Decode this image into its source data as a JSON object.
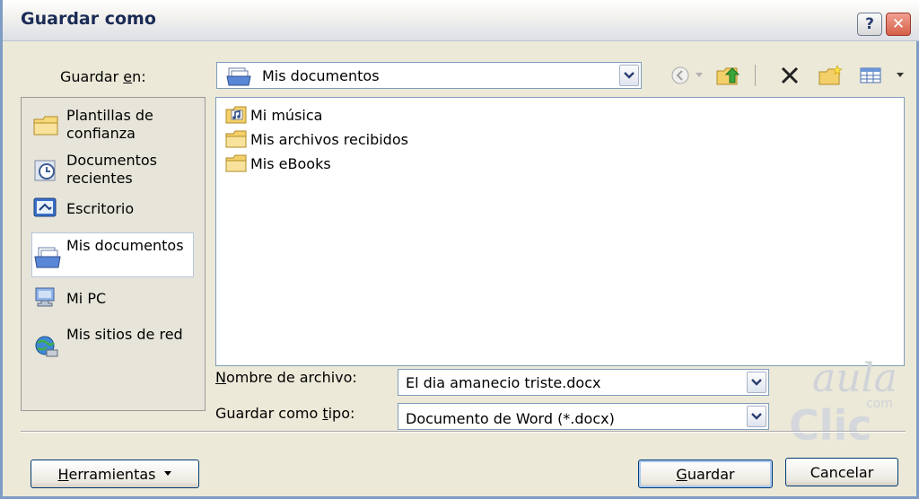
{
  "window": {
    "title": "Guardar como",
    "help_label": "?",
    "close_label": "✕"
  },
  "save_in": {
    "label_pre": "Guardar ",
    "label_key": "e",
    "label_post": "n:",
    "value": "Mis documentos",
    "icon": "documents-folder-icon"
  },
  "toolbar": {
    "icons": [
      "back-icon",
      "up-folder-icon",
      "delete-icon",
      "new-folder-icon",
      "views-icon"
    ]
  },
  "places": [
    {
      "label": "Plantillas de confianza",
      "icon": "folder-icon"
    },
    {
      "label": "Documentos recientes",
      "icon": "recent-documents-icon"
    },
    {
      "label": "Escritorio",
      "icon": "desktop-icon"
    },
    {
      "label": "Mis documentos",
      "icon": "my-documents-icon",
      "selected": true
    },
    {
      "label": "Mi PC",
      "icon": "my-computer-icon"
    },
    {
      "label": "Mis sitios de red",
      "icon": "network-places-icon"
    }
  ],
  "files": [
    {
      "name": "Mi música",
      "icon": "music-folder-icon"
    },
    {
      "name": "Mis archivos recibidos",
      "icon": "folder-icon"
    },
    {
      "name": "Mis eBooks",
      "icon": "folder-icon"
    }
  ],
  "filename": {
    "label_key": "N",
    "label_post": "ombre de archivo:",
    "value": "El dia amanecio triste.docx"
  },
  "filetype": {
    "label_pre": "Guardar como ",
    "label_key": "t",
    "label_post": "ipo:",
    "value": "Documento de Word (*.docx)"
  },
  "buttons": {
    "tools_key": "H",
    "tools_post": "erramientas",
    "save_key": "G",
    "save_post": "uardar",
    "cancel": "Cancelar"
  },
  "watermark": {
    "aula": "aula",
    "com": "com",
    "clic": "Clic"
  },
  "colors": {
    "window_bg": "#ece9d8",
    "title_text": "#1a2b55",
    "selection_border": "#b8c6dc",
    "field_border": "#7f9db9"
  }
}
